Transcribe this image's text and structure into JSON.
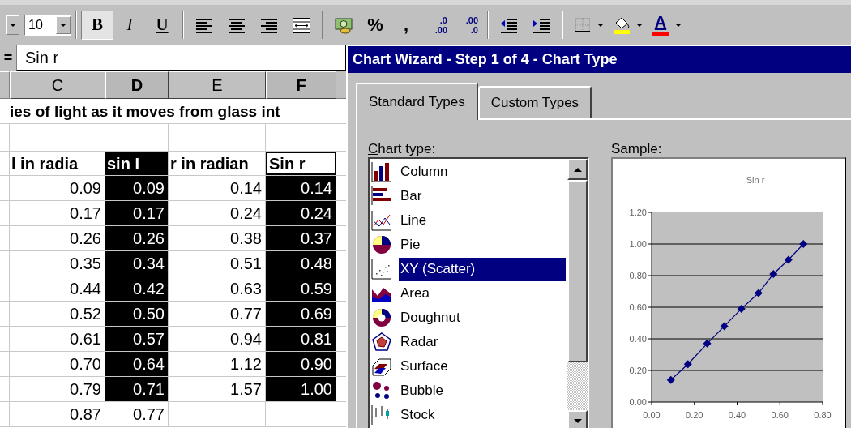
{
  "toolbar": {
    "items": [
      {
        "kind": "font-name-arrow"
      },
      {
        "kind": "font-size",
        "label": "10"
      },
      {
        "kind": "separator"
      },
      {
        "kind": "bold",
        "label": "B",
        "selected": true
      },
      {
        "kind": "italic",
        "label": "I",
        "selected": false
      },
      {
        "kind": "underline",
        "label": "U",
        "selected": false
      },
      {
        "kind": "separator"
      },
      {
        "kind": "align-left"
      },
      {
        "kind": "align-center"
      },
      {
        "kind": "align-right"
      },
      {
        "kind": "merge"
      },
      {
        "kind": "separator"
      },
      {
        "kind": "currency"
      },
      {
        "kind": "percent",
        "label": "%"
      },
      {
        "kind": "comma",
        "label": ","
      },
      {
        "kind": "increase-decimal",
        "labels": [
          ".0",
          ".00"
        ]
      },
      {
        "kind": "decrease-decimal",
        "labels": [
          ".00",
          ".0"
        ]
      },
      {
        "kind": "separator"
      },
      {
        "kind": "outdent"
      },
      {
        "kind": "indent"
      },
      {
        "kind": "separator"
      },
      {
        "kind": "borders"
      },
      {
        "kind": "fill-color"
      },
      {
        "kind": "font-color",
        "label": "A"
      }
    ]
  },
  "formula_bar": {
    "equals": "=",
    "value": "Sin r"
  },
  "sheet": {
    "columns": [
      {
        "label": "C",
        "selected": false
      },
      {
        "label": "D",
        "selected": true
      },
      {
        "label": "E",
        "selected": false
      },
      {
        "label": "F",
        "selected": true
      }
    ],
    "title_row": "ies of light as it moves from glass int",
    "rows": [
      {
        "kind": "heading",
        "cells": [
          {
            "text": "l in radia",
            "selected": false,
            "active": false
          },
          {
            "text": "sin I",
            "selected": true,
            "active": false
          },
          {
            "text": "r in radian",
            "selected": false,
            "active": false
          },
          {
            "text": "Sin r",
            "selected": true,
            "active": true
          }
        ]
      },
      {
        "kind": "data",
        "cells": [
          {
            "text": "0.09",
            "selected": false,
            "active": false
          },
          {
            "text": "0.09",
            "selected": true,
            "active": false
          },
          {
            "text": "0.14",
            "selected": false,
            "active": false
          },
          {
            "text": "0.14",
            "selected": true,
            "active": false
          }
        ]
      },
      {
        "kind": "data",
        "cells": [
          {
            "text": "0.17",
            "selected": false,
            "active": false
          },
          {
            "text": "0.17",
            "selected": true,
            "active": false
          },
          {
            "text": "0.24",
            "selected": false,
            "active": false
          },
          {
            "text": "0.24",
            "selected": true,
            "active": false
          }
        ]
      },
      {
        "kind": "data",
        "cells": [
          {
            "text": "0.26",
            "selected": false,
            "active": false
          },
          {
            "text": "0.26",
            "selected": true,
            "active": false
          },
          {
            "text": "0.38",
            "selected": false,
            "active": false
          },
          {
            "text": "0.37",
            "selected": true,
            "active": false
          }
        ]
      },
      {
        "kind": "data",
        "cells": [
          {
            "text": "0.35",
            "selected": false,
            "active": false
          },
          {
            "text": "0.34",
            "selected": true,
            "active": false
          },
          {
            "text": "0.51",
            "selected": false,
            "active": false
          },
          {
            "text": "0.48",
            "selected": true,
            "active": false
          }
        ]
      },
      {
        "kind": "data",
        "cells": [
          {
            "text": "0.44",
            "selected": false,
            "active": false
          },
          {
            "text": "0.42",
            "selected": true,
            "active": false
          },
          {
            "text": "0.63",
            "selected": false,
            "active": false
          },
          {
            "text": "0.59",
            "selected": true,
            "active": false
          }
        ]
      },
      {
        "kind": "data",
        "cells": [
          {
            "text": "0.52",
            "selected": false,
            "active": false
          },
          {
            "text": "0.50",
            "selected": true,
            "active": false
          },
          {
            "text": "0.77",
            "selected": false,
            "active": false
          },
          {
            "text": "0.69",
            "selected": true,
            "active": false
          }
        ]
      },
      {
        "kind": "data",
        "cells": [
          {
            "text": "0.61",
            "selected": false,
            "active": false
          },
          {
            "text": "0.57",
            "selected": true,
            "active": false
          },
          {
            "text": "0.94",
            "selected": false,
            "active": false
          },
          {
            "text": "0.81",
            "selected": true,
            "active": false
          }
        ]
      },
      {
        "kind": "data",
        "cells": [
          {
            "text": "0.70",
            "selected": false,
            "active": false
          },
          {
            "text": "0.64",
            "selected": true,
            "active": false
          },
          {
            "text": "1.12",
            "selected": false,
            "active": false
          },
          {
            "text": "0.90",
            "selected": true,
            "active": false
          }
        ]
      },
      {
        "kind": "data",
        "cells": [
          {
            "text": "0.79",
            "selected": false,
            "active": false
          },
          {
            "text": "0.71",
            "selected": true,
            "active": false
          },
          {
            "text": "1.57",
            "selected": false,
            "active": false
          },
          {
            "text": "1.00",
            "selected": true,
            "active": false
          }
        ]
      },
      {
        "kind": "data",
        "cells": [
          {
            "text": "0.87",
            "selected": false,
            "active": false
          },
          {
            "text": "0.77",
            "selected": false,
            "active": false
          }
        ]
      }
    ]
  },
  "dialog": {
    "title": "Chart Wizard - Step 1 of 4 - Chart Type",
    "tabs": [
      {
        "label": "Standard Types",
        "selected": true
      },
      {
        "label": "Custom Types",
        "selected": false
      }
    ],
    "chart_type_label": "Chart type:",
    "chart_types": [
      {
        "kind": "column",
        "label": "Column",
        "selected": false
      },
      {
        "kind": "bar",
        "label": "Bar",
        "selected": false
      },
      {
        "kind": "line",
        "label": "Line",
        "selected": false
      },
      {
        "kind": "pie",
        "label": "Pie",
        "selected": false
      },
      {
        "kind": "scatter",
        "label": "XY (Scatter)",
        "selected": true
      },
      {
        "kind": "area",
        "label": "Area",
        "selected": false
      },
      {
        "kind": "doughnut",
        "label": "Doughnut",
        "selected": false
      },
      {
        "kind": "radar",
        "label": "Radar",
        "selected": false
      },
      {
        "kind": "surface",
        "label": "Surface",
        "selected": false
      },
      {
        "kind": "bubble",
        "label": "Bubble",
        "selected": false
      },
      {
        "kind": "stock",
        "label": "Stock",
        "selected": false
      }
    ],
    "sample_label": "Sample:",
    "chart_data": {
      "type": "line",
      "title": "Sin r",
      "x": [
        0.09,
        0.17,
        0.26,
        0.34,
        0.42,
        0.5,
        0.57,
        0.64,
        0.71
      ],
      "grid": true,
      "series": [
        {
          "color": "#000080",
          "marker": "diamond",
          "values": [
            0.14,
            0.24,
            0.37,
            0.48,
            0.59,
            0.69,
            0.81,
            0.9,
            1.0
          ]
        }
      ],
      "xlim": [
        0,
        0.8
      ],
      "ylim": [
        0,
        1.2
      ],
      "xticks": [
        {
          "value": 0,
          "label": "0.00"
        },
        {
          "value": 0.2,
          "label": "0.20"
        },
        {
          "value": 0.4,
          "label": "0.40"
        },
        {
          "value": 0.6,
          "label": "0.60"
        },
        {
          "value": 0.8,
          "label": "0.80"
        }
      ],
      "yticks": [
        {
          "value": 0,
          "label": "0.00"
        },
        {
          "value": 0.2,
          "label": "0.20"
        },
        {
          "value": 0.4,
          "label": "0.40"
        },
        {
          "value": 0.6,
          "label": "0.60"
        },
        {
          "value": 0.8,
          "label": "0.80"
        },
        {
          "value": 1,
          "label": "1.00"
        },
        {
          "value": 1.2,
          "label": "1.20"
        }
      ]
    }
  }
}
